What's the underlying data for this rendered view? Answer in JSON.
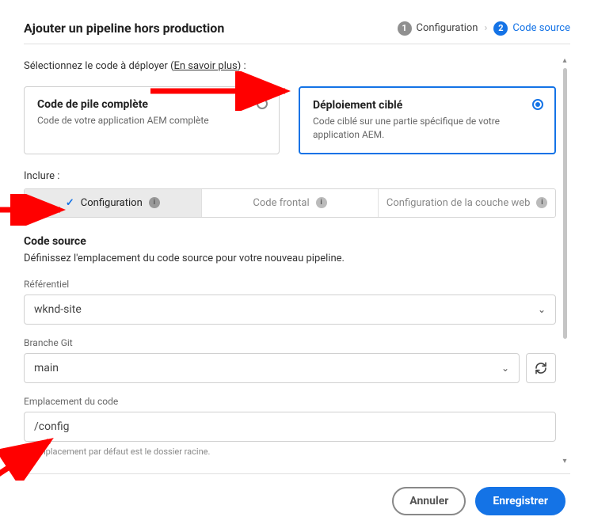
{
  "header": {
    "title": "Ajouter un pipeline hors production",
    "step1_label": "Configuration",
    "step2_label": "Code source"
  },
  "deploy": {
    "intro_prefix": "Sélectionnez le code à déployer (",
    "learn_more": "En savoir plus",
    "intro_suffix": ") :",
    "card_full_title": "Code de pile complète",
    "card_full_desc": "Code de votre application AEM complète",
    "card_targeted_title": "Déploiement ciblé",
    "card_targeted_desc": "Code ciblé sur une partie spécifique de votre application AEM."
  },
  "include": {
    "label": "Inclure :",
    "tab_config": "Configuration",
    "tab_frontend": "Code frontal",
    "tab_weblayer": "Configuration de la couche web"
  },
  "source": {
    "heading": "Code source",
    "desc": "Définissez l'emplacement du code source pour votre nouveau pipeline.",
    "repo_label": "Référentiel",
    "repo_value": "wknd-site",
    "branch_label": "Branche Git",
    "branch_value": "main",
    "location_label": "Emplacement du code",
    "location_value": "/config",
    "location_hint": "mplacement par défaut est le dossier racine."
  },
  "footer": {
    "cancel": "Annuler",
    "save": "Enregistrer"
  }
}
